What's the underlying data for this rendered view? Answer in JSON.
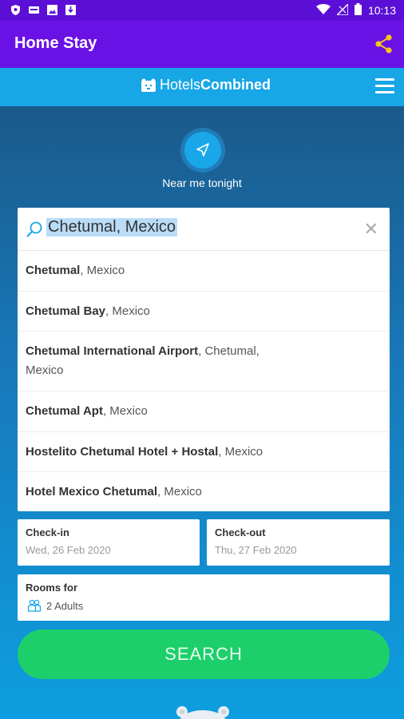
{
  "status_bar": {
    "time": "10:13",
    "icons": [
      "shield-icon",
      "voicemail-icon",
      "image-icon",
      "download-icon",
      "wifi-icon",
      "signal-icon",
      "battery-icon"
    ]
  },
  "app_bar": {
    "title": "Home Stay",
    "share_icon": "share-icon"
  },
  "hotels_bar": {
    "logo_part1": "Hotels",
    "logo_part2": "Combined",
    "menu_icon": "hamburger-menu-icon"
  },
  "near_me": {
    "label": "Near me tonight"
  },
  "search": {
    "query": "Chetumal, Mexico"
  },
  "suggestions": [
    {
      "bold": "Chetumal",
      "rest": ", Mexico"
    },
    {
      "bold": "Chetumal Bay",
      "rest": ", Mexico"
    },
    {
      "bold": "Chetumal International Airport",
      "rest": ", Chetumal,",
      "rest2": "Mexico"
    },
    {
      "bold": "Chetumal Apt",
      "rest": ", Mexico"
    },
    {
      "bold": "Hostelito Chetumal Hotel + Hostal",
      "rest": ", Mexico"
    },
    {
      "bold": "Hotel Mexico Chetumal",
      "rest": ", Mexico"
    }
  ],
  "checkin": {
    "label": "Check-in",
    "value": "Wed, 26 Feb 2020"
  },
  "checkout": {
    "label": "Check-out",
    "value": "Thu, 27 Feb 2020"
  },
  "rooms": {
    "label": "Rooms for",
    "value": "2 Adults"
  },
  "search_button": "SEARCH",
  "colors": {
    "app_bar": "#6a12e6",
    "hotels_bar": "#17a6e6",
    "search_button": "#1dcf6a",
    "share_icon": "#f5c518"
  }
}
